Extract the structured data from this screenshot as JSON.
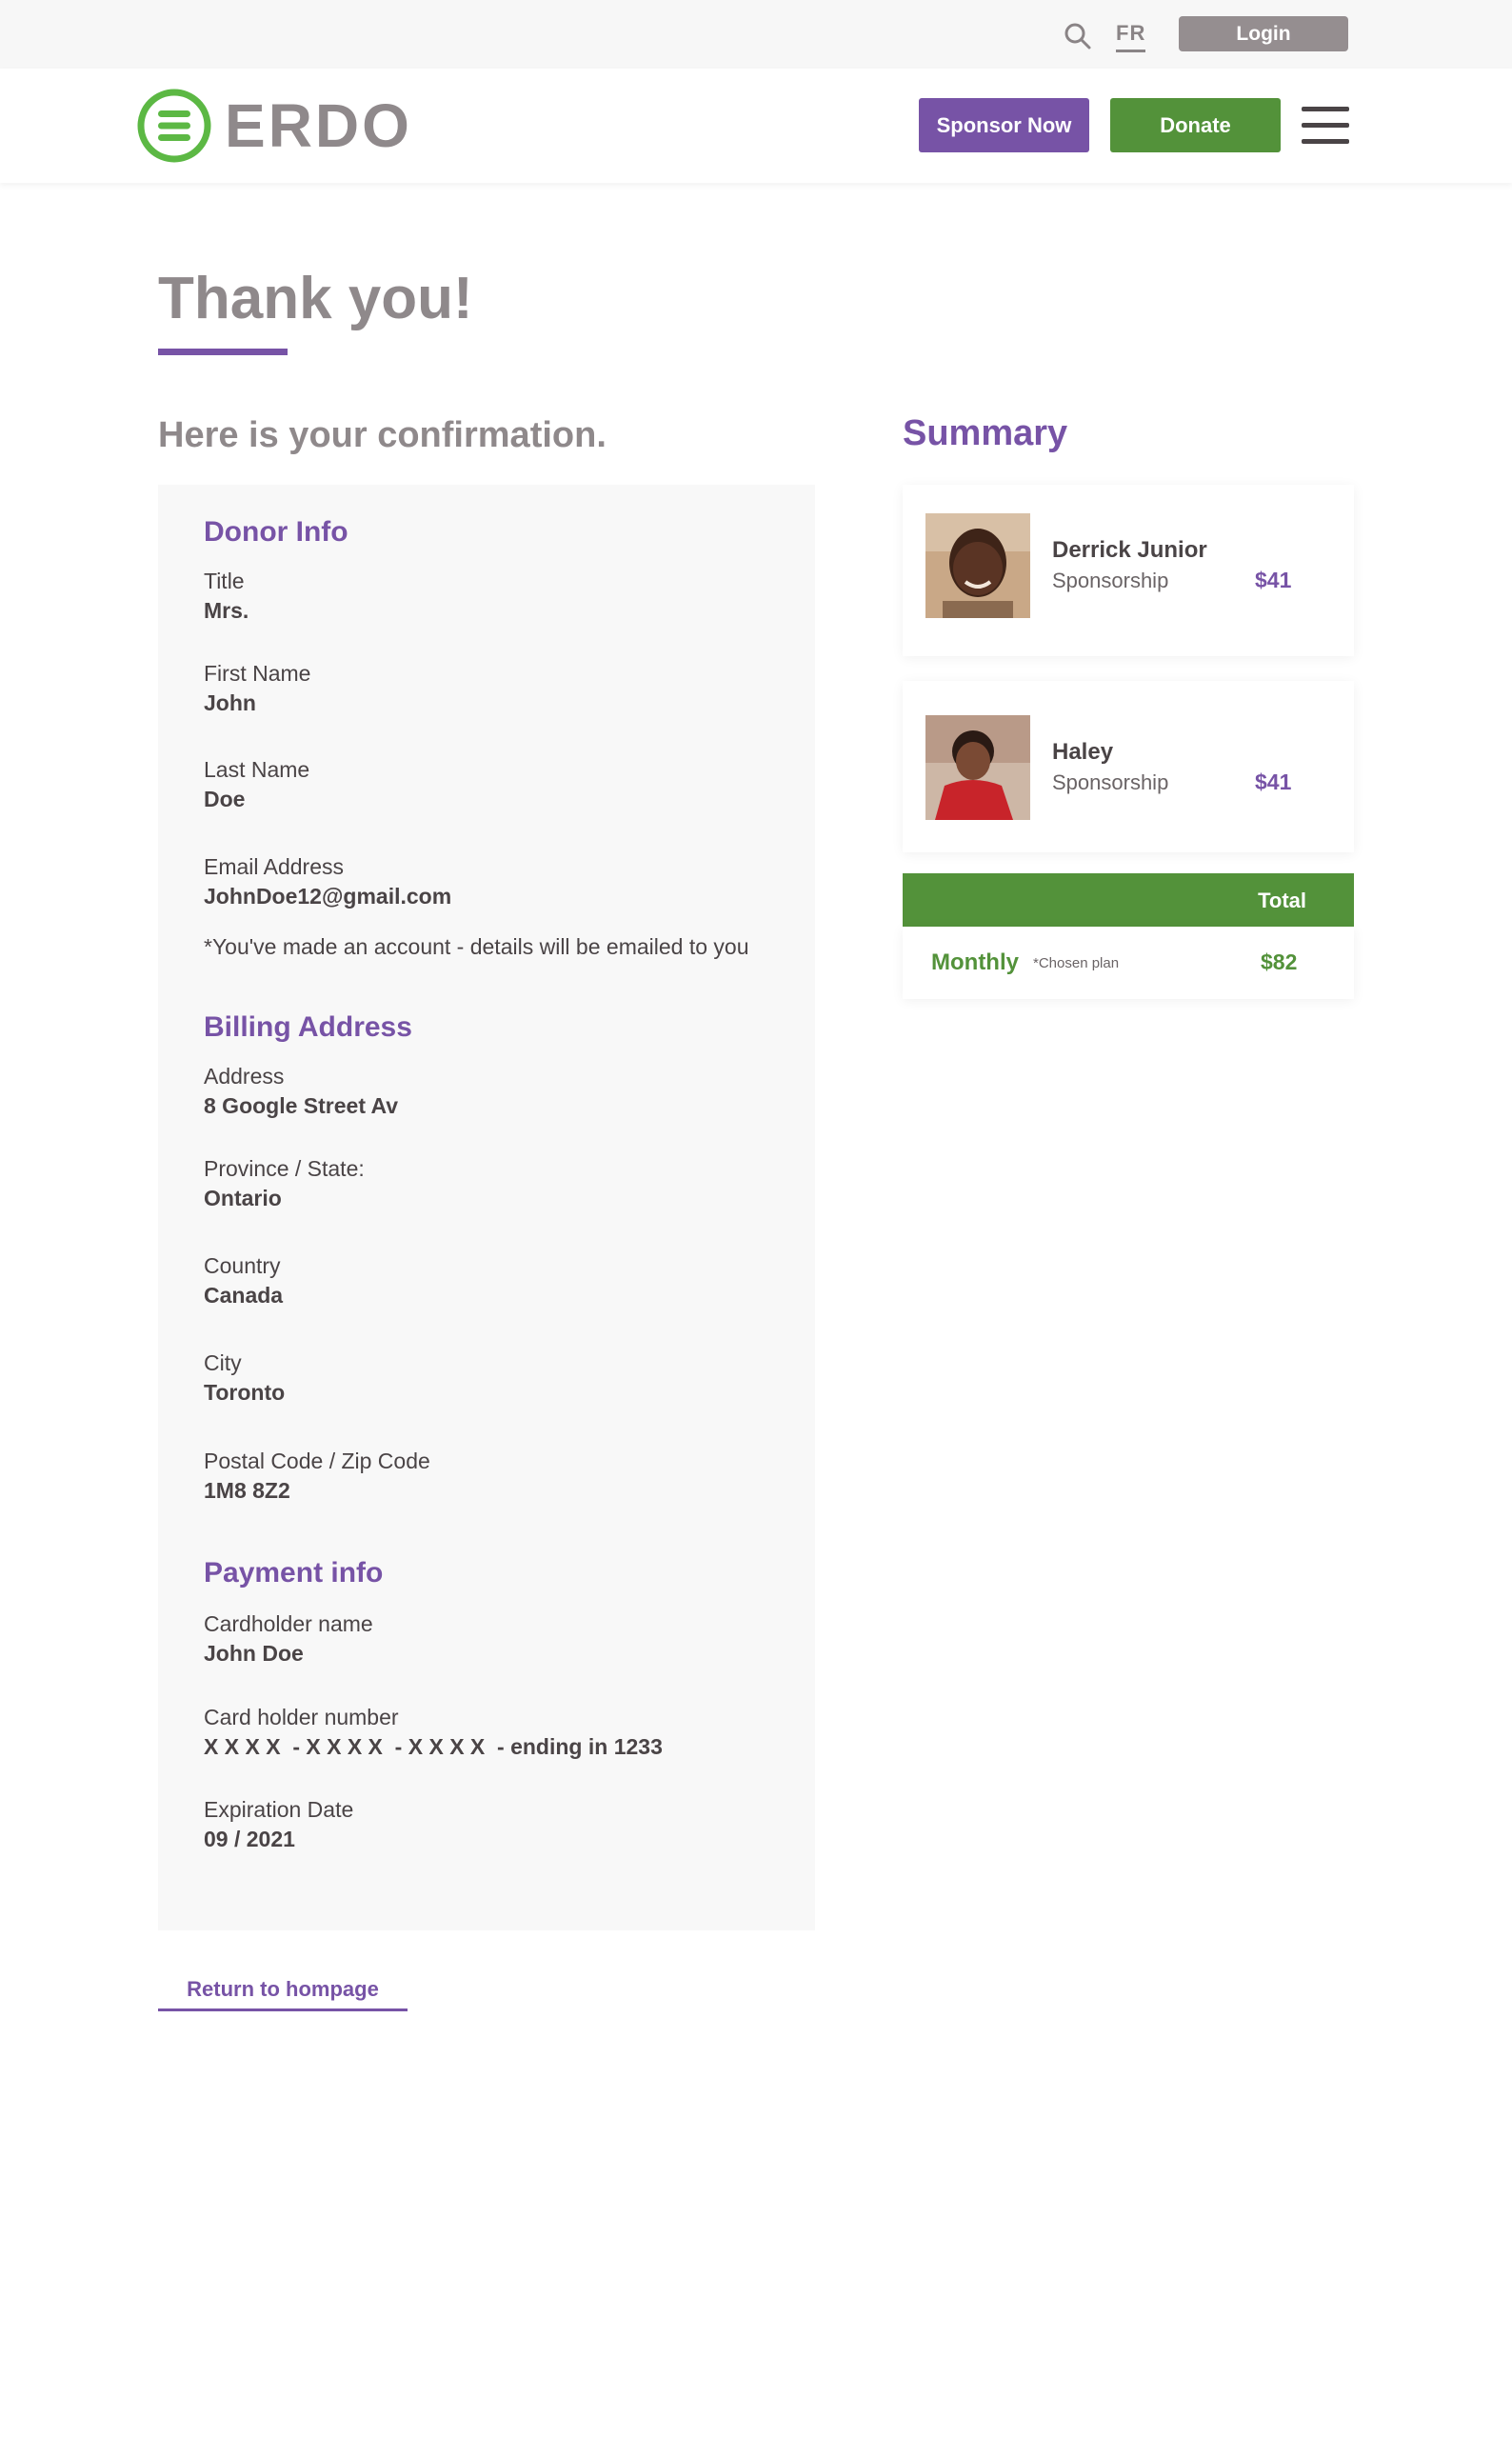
{
  "utility": {
    "lang": "FR",
    "login_label": "Login"
  },
  "header": {
    "brand": "ERDO",
    "sponsor_label": "Sponsor Now",
    "donate_label": "Donate"
  },
  "page": {
    "title": "Thank you!",
    "confirmation_heading": "Here is your confirmation.",
    "summary_heading": "Summary",
    "return_label": "Return to hompage"
  },
  "donor": {
    "heading": "Donor Info",
    "title_label": "Title",
    "title_value": "Mrs.",
    "first_label": "First Name",
    "first_value": "John",
    "last_label": "Last Name",
    "last_value": "Doe",
    "email_label": "Email Address",
    "email_value": "JohnDoe12@gmail.com",
    "note": "*You've made an account - details will be emailed to you"
  },
  "billing": {
    "heading": "Billing Address",
    "address_label": "Address",
    "address_value": "8 Google Street Av",
    "province_label": "Province / State:",
    "province_value": "Ontario",
    "country_label": "Country",
    "country_value": "Canada",
    "city_label": "City",
    "city_value": "Toronto",
    "postal_label": "Postal Code / Zip Code",
    "postal_value": "1M8 8Z2"
  },
  "payment": {
    "heading": "Payment info",
    "cardholder_label": "Cardholder name",
    "cardholder_value": "John Doe",
    "number_label": "Card holder number",
    "number_value": "X X X X  - X X X X  - X X X X  - ending in 1233",
    "expiry_label": "Expiration Date",
    "expiry_value": "09 / 2021"
  },
  "summary": {
    "items": [
      {
        "name": "Derrick Junior",
        "type": "Sponsorship",
        "amount": "$41"
      },
      {
        "name": "Haley",
        "type": "Sponsorship",
        "amount": "$41"
      }
    ],
    "total_label": "Total",
    "plan": "Monthly",
    "plan_note": "*Chosen plan",
    "total_amount": "$82"
  },
  "colors": {
    "purple": "#7753a6",
    "green": "#53923a",
    "gray": "#8f898b"
  }
}
